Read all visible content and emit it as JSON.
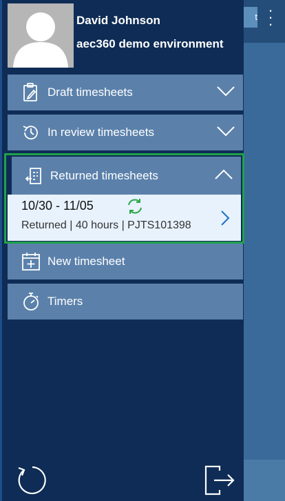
{
  "user": {
    "name": "David Johnson",
    "environment": "aec360 demo environment"
  },
  "menu": {
    "draft": {
      "label": "Draft timesheets",
      "icon": "clipboard-edit-icon"
    },
    "review": {
      "label": "In review timesheets",
      "icon": "history-icon"
    },
    "returned": {
      "label": "Returned timesheets",
      "icon": "returned-doc-icon"
    },
    "new": {
      "label": "New timesheet",
      "icon": "calendar-add-icon"
    },
    "timers": {
      "label": "Timers",
      "icon": "stopwatch-icon"
    }
  },
  "returned_item": {
    "dates": "10/30 - 11/05",
    "meta": "Returned | 40 hours | PJTS101398"
  },
  "background": {
    "button_text": "t"
  },
  "colors": {
    "drawer": "#0e2c55",
    "item": "#5b81ab",
    "highlight": "#1fa14a",
    "card": "#e8f2fd",
    "sync": "#2ba84a",
    "link": "#1a6fc4"
  }
}
